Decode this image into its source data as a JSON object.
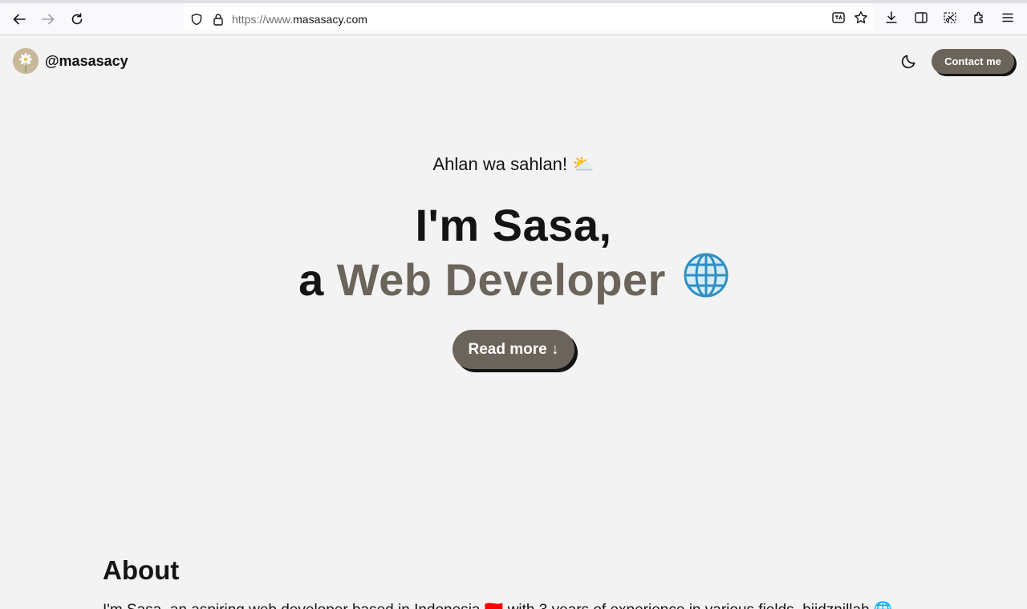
{
  "browser": {
    "url_prefix": "https://www.",
    "url_domain": "masasacy.com",
    "icons": [
      "back-icon",
      "forward-icon",
      "reload-icon",
      "shield-icon",
      "lock-icon",
      "translate-icon",
      "bookmark-star-icon",
      "download-icon",
      "sidebar-icon",
      "screenshot-icon",
      "extensions-icon",
      "menu-icon"
    ]
  },
  "header": {
    "handle": "@masasacy",
    "contact_label": "Contact me",
    "theme_icon": "moon-icon"
  },
  "hero": {
    "greeting": "Ahlan wa sahlan! ⛅",
    "line1": "I'm Sasa,",
    "line2_prefix": "a",
    "line2_accent": "Web Developer",
    "read_more_label": "Read more ↓"
  },
  "about": {
    "title": "About",
    "text": "I'm Sasa, an aspiring web developer based in Indonesia 🇮🇩 with 3 years of experience in various fields, biidznillah 🌐"
  },
  "colors": {
    "accent": "#6b645a",
    "background": "#f3f3f3",
    "text": "#141414"
  }
}
